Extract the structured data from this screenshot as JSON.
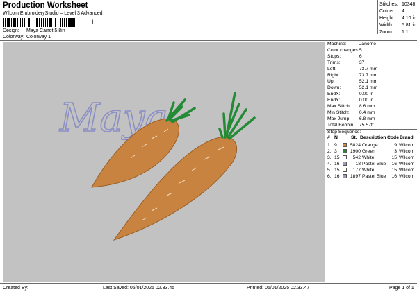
{
  "header": {
    "title": "Production Worksheet",
    "subtitle": "Wilcom EmbroideryStudio – Level 3 Advanced",
    "barcode_text": "I"
  },
  "design": {
    "design_label": "Design:",
    "design_value": "Maya Carrot 5,8in",
    "colorway_label": "Colorway:",
    "colorway_value": "Colorway 1"
  },
  "summary": [
    {
      "label": "Stitches:",
      "value": "10348"
    },
    {
      "label": "Colors:",
      "value": "4"
    },
    {
      "label": "Height:",
      "value": "4.10 in"
    },
    {
      "label": "Width:",
      "value": "5.81 in"
    },
    {
      "label": "Zoom:",
      "value": "1:1"
    }
  ],
  "canvas": {
    "text": "Maya",
    "text_color": "#9a9ccc",
    "carrot_color": "#c8803c",
    "leaf_color": "#2e8f3c"
  },
  "machine": [
    {
      "label": "Machine:",
      "value": "Janome"
    },
    {
      "label": "Color changes:",
      "value": "5"
    },
    {
      "label": "Stops:",
      "value": "6"
    },
    {
      "label": "Trims:",
      "value": "37"
    },
    {
      "label": "Left:",
      "value": "73.7 mm"
    },
    {
      "label": "Right:",
      "value": "73.7 mm"
    },
    {
      "label": "Up:",
      "value": "52.1 mm"
    },
    {
      "label": "Down:",
      "value": "52.1 mm"
    },
    {
      "label": "EndX:",
      "value": "0.00 in"
    },
    {
      "label": "EndY:",
      "value": "0.00 in"
    },
    {
      "label": "Max Stitch:",
      "value": "8.6 mm"
    },
    {
      "label": "Min Stitch:",
      "value": "0.4 mm"
    },
    {
      "label": "Max Jump:",
      "value": "6.8 mm"
    },
    {
      "label": "Total Bobbin:",
      "value": "75.57ft"
    }
  ],
  "stop_sequence": {
    "title": "Stop Sequence:",
    "columns": [
      "#",
      "N",
      "St.",
      "Description",
      "Code",
      "Brand"
    ],
    "rows": [
      {
        "num": "1.",
        "n": "9",
        "color": "#e08a2c",
        "st": "5824",
        "desc": "Orange",
        "code": "9",
        "brand": "Wilcom"
      },
      {
        "num": "2.",
        "n": "3",
        "color": "#1e8c3a",
        "st": "1900",
        "desc": "Green",
        "code": "3",
        "brand": "Wilcom"
      },
      {
        "num": "3.",
        "n": "15",
        "color": "#ffffff",
        "st": "542",
        "desc": "White",
        "code": "15",
        "brand": "Wilcom"
      },
      {
        "num": "4.",
        "n": "16",
        "color": "#9a9cc8",
        "st": "18",
        "desc": "Pastel Blue",
        "code": "16",
        "brand": "Wilcom"
      },
      {
        "num": "5.",
        "n": "15",
        "color": "#ffffff",
        "st": "177",
        "desc": "White",
        "code": "15",
        "brand": "Wilcom"
      },
      {
        "num": "6.",
        "n": "16",
        "color": "#9a9cc8",
        "st": "1897",
        "desc": "Pastel Blue",
        "code": "16",
        "brand": "Wilcom"
      }
    ]
  },
  "footer": {
    "created_by": "Created By:",
    "last_saved": "Last Saved: 05/01/2025 02.33.45",
    "printed": "Printed: 05/01/2025 02.33.47",
    "page": "Page 1 of 1"
  }
}
